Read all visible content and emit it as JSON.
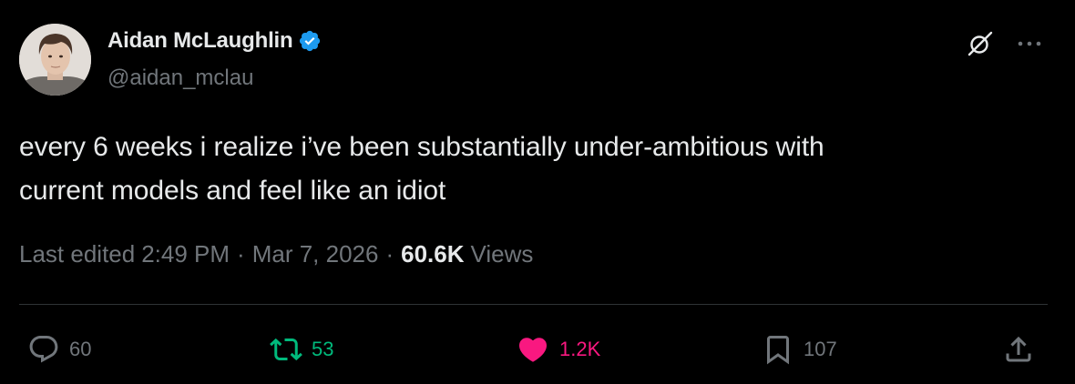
{
  "author": {
    "display_name": "Aidan McLaughlin",
    "handle": "@aidan_mclau",
    "verified": true
  },
  "tweet": {
    "text": "every 6 weeks i realize i’ve been substantially under-ambitious with\ncurrent models and feel like an idiot"
  },
  "meta": {
    "edited_label": "Last edited",
    "time": "2:49 PM",
    "separator": "·",
    "date": "Mar 7, 2026",
    "views_count": "60.6K",
    "views_label": "Views"
  },
  "actions": {
    "replies": "60",
    "reposts": "53",
    "likes": "1.2K",
    "bookmarks": "107"
  },
  "icons": {
    "header": [
      "grok-icon",
      "more-icon"
    ],
    "actions": [
      "reply-icon",
      "repost-icon",
      "like-icon",
      "bookmark-icon",
      "share-icon"
    ]
  },
  "colors": {
    "background": "#000000",
    "text": "#e7e9ea",
    "secondary": "#71767b",
    "verified": "#1d9bf0",
    "repost_active": "#00ba7c",
    "like_active": "#f91880",
    "divider": "#2f3336"
  }
}
